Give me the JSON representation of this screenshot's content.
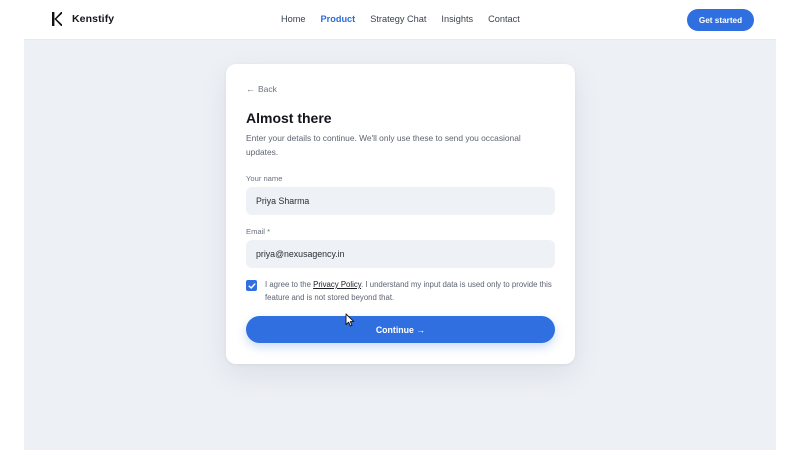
{
  "header": {
    "brand_name": "Kenstify",
    "nav": [
      {
        "label": "Home",
        "active": false
      },
      {
        "label": "Product",
        "active": true
      },
      {
        "label": "Strategy Chat",
        "active": false
      },
      {
        "label": "Insights",
        "active": false
      },
      {
        "label": "Contact",
        "active": false
      }
    ],
    "cta_label": "Get started"
  },
  "form": {
    "back_label": "Back",
    "title": "Almost there",
    "subtitle": "Enter your details to continue. We'll only use these to send you occasional updates.",
    "name_label": "Your name",
    "name_value": "Priya Sharma",
    "email_label": "Email *",
    "email_value": "priya@nexusagency.in",
    "consent_checked": true,
    "consent_prefix": "I agree to the ",
    "consent_link": "Privacy Policy",
    "consent_suffix": ". I understand my input data is used only to provide this feature and is not stored beyond that.",
    "continue_label": "Continue →"
  },
  "colors": {
    "accent": "#2f6fdf",
    "page_bg": "#edf0f5",
    "field_bg": "#eef1f5"
  },
  "icons": {
    "brand": "k-logo-icon",
    "back": "arrow-left-icon",
    "checkbox": "check-icon",
    "cursor": "mouse-pointer-icon"
  }
}
